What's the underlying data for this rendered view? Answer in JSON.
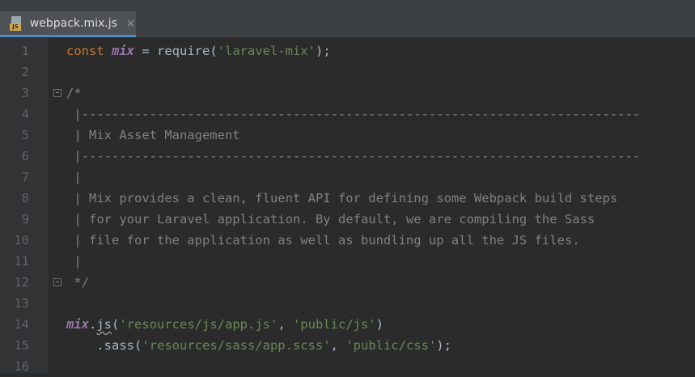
{
  "tab": {
    "filename": "webpack.mix.js",
    "icon_badge": "JS",
    "close_glyph": "×"
  },
  "lines": [
    {
      "n": "1",
      "tokens": [
        [
          "kw",
          "const "
        ],
        [
          "var",
          "mix"
        ],
        [
          "fn",
          " = require("
        ],
        [
          "str",
          "'laravel-mix'"
        ],
        [
          "fn",
          ");"
        ]
      ]
    },
    {
      "n": "2",
      "tokens": []
    },
    {
      "n": "3",
      "tokens": [
        [
          "cmt",
          "/*"
        ]
      ],
      "fold": true
    },
    {
      "n": "4",
      "tokens": [
        [
          "cmt",
          " |--------------------------------------------------------------------------"
        ]
      ]
    },
    {
      "n": "5",
      "tokens": [
        [
          "cmt",
          " | Mix Asset Management"
        ]
      ]
    },
    {
      "n": "6",
      "tokens": [
        [
          "cmt",
          " |--------------------------------------------------------------------------"
        ]
      ]
    },
    {
      "n": "7",
      "tokens": [
        [
          "cmt",
          " |"
        ]
      ]
    },
    {
      "n": "8",
      "tokens": [
        [
          "cmt",
          " | Mix provides a clean, fluent API for defining some Webpack build steps"
        ]
      ]
    },
    {
      "n": "9",
      "tokens": [
        [
          "cmt",
          " | for your Laravel application. By default, we are compiling the Sass"
        ]
      ]
    },
    {
      "n": "10",
      "tokens": [
        [
          "cmt",
          " | file for the application as well as bundling up all the JS files."
        ]
      ]
    },
    {
      "n": "11",
      "tokens": [
        [
          "cmt",
          " |"
        ]
      ]
    },
    {
      "n": "12",
      "tokens": [
        [
          "cmt",
          " */"
        ]
      ],
      "fold": true
    },
    {
      "n": "13",
      "tokens": []
    },
    {
      "n": "14",
      "tokens": [
        [
          "var",
          "mix"
        ],
        [
          "fn",
          "."
        ],
        [
          "squig",
          "js"
        ],
        [
          "fn",
          "("
        ],
        [
          "str",
          "'resources/js/app.js'"
        ],
        [
          "fn",
          ", "
        ],
        [
          "str",
          "'public/js'"
        ],
        [
          "fn",
          ")"
        ]
      ]
    },
    {
      "n": "15",
      "tokens": [
        [
          "fn",
          "    .sass("
        ],
        [
          "str",
          "'resources/sass/app.scss'"
        ],
        [
          "fn",
          ", "
        ],
        [
          "str",
          "'public/css'"
        ],
        [
          "fn",
          ");"
        ]
      ]
    },
    {
      "n": "16",
      "tokens": []
    }
  ],
  "colors": {
    "keyword": "#cc7832",
    "variable": "#9876aa",
    "string": "#6a8759",
    "comment": "#808080",
    "text": "#a9b7c6",
    "tab_underline": "#4a88c7"
  }
}
